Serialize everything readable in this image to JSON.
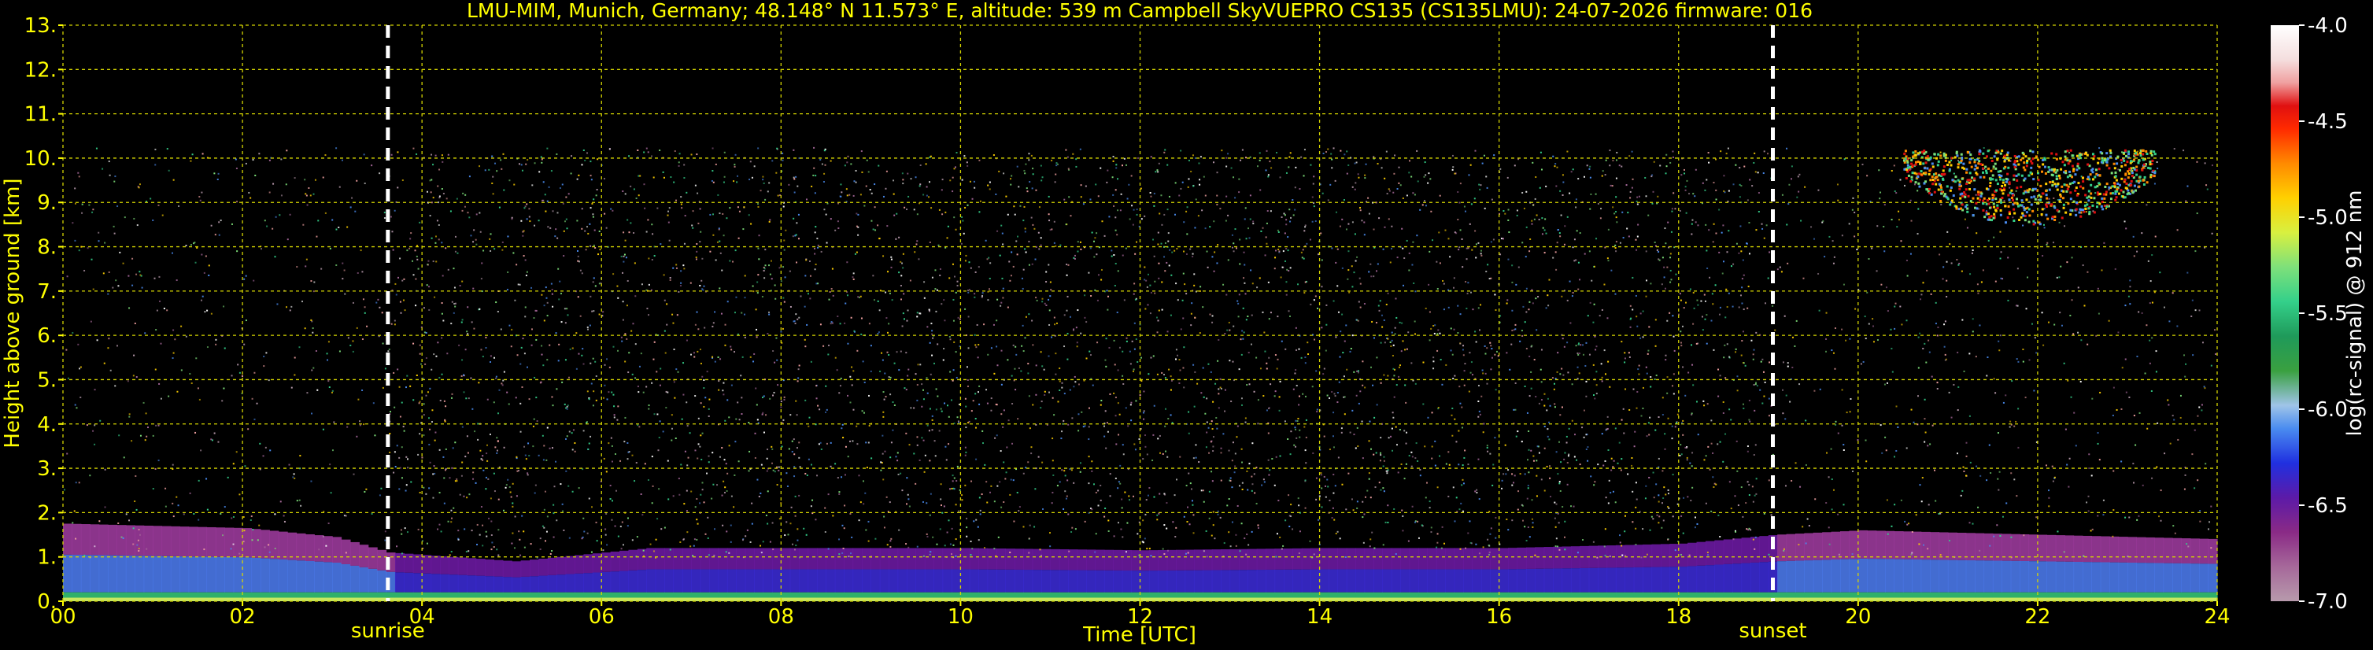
{
  "chart_data": {
    "type": "heatmap",
    "title": "LMU-MIM, Munich, Germany; 48.148° N 11.573° E, altitude: 539 m    Campbell SkyVUEPRO CS135 (CS135LMU): 24-07-2026    firmware: 016",
    "xlabel": "Time [UTC]",
    "ylabel": "Height above ground [km]",
    "x_ticks": [
      "00",
      "02",
      "04",
      "06",
      "08",
      "10",
      "12",
      "14",
      "16",
      "18",
      "20",
      "22",
      "24"
    ],
    "y_ticks": [
      "0.",
      "1.",
      "2.",
      "3.",
      "4.",
      "5.",
      "6.",
      "7.",
      "8.",
      "9.",
      "10.",
      "11.",
      "12.",
      "13."
    ],
    "xlim": [
      0,
      24
    ],
    "ylim": [
      0,
      13
    ],
    "grid": true,
    "colorbar": {
      "label": "log(rc-signal) @ 912 nm",
      "ticks": [
        "-4.0",
        "-4.5",
        "-5.0",
        "-5.5",
        "-6.0",
        "-6.5",
        "-7.0"
      ],
      "range": [
        -7.0,
        -4.0
      ]
    },
    "events": [
      {
        "name": "sunrise",
        "time_h": 3.62
      },
      {
        "name": "sunset",
        "time_h": 19.05
      }
    ],
    "features": {
      "boundary_layer_top_km": [
        [
          0.0,
          1.75
        ],
        [
          1.0,
          1.7
        ],
        [
          2.0,
          1.65
        ],
        [
          3.0,
          1.45
        ],
        [
          3.6,
          1.1
        ],
        [
          5.0,
          0.9
        ],
        [
          6.5,
          1.2
        ],
        [
          8.0,
          1.2
        ],
        [
          10.0,
          1.2
        ],
        [
          12.0,
          1.15
        ],
        [
          14.0,
          1.2
        ],
        [
          16.0,
          1.2
        ],
        [
          18.0,
          1.3
        ],
        [
          19.05,
          1.5
        ],
        [
          20.0,
          1.6
        ],
        [
          21.0,
          1.55
        ],
        [
          22.0,
          1.5
        ],
        [
          23.0,
          1.45
        ],
        [
          24.0,
          1.4
        ]
      ],
      "cirrus_cloud": {
        "time_start_h": 20.5,
        "time_end_h": 23.3,
        "base_km": 8.5,
        "top_km": 10.2
      },
      "profile_top_km": 10.25
    }
  }
}
